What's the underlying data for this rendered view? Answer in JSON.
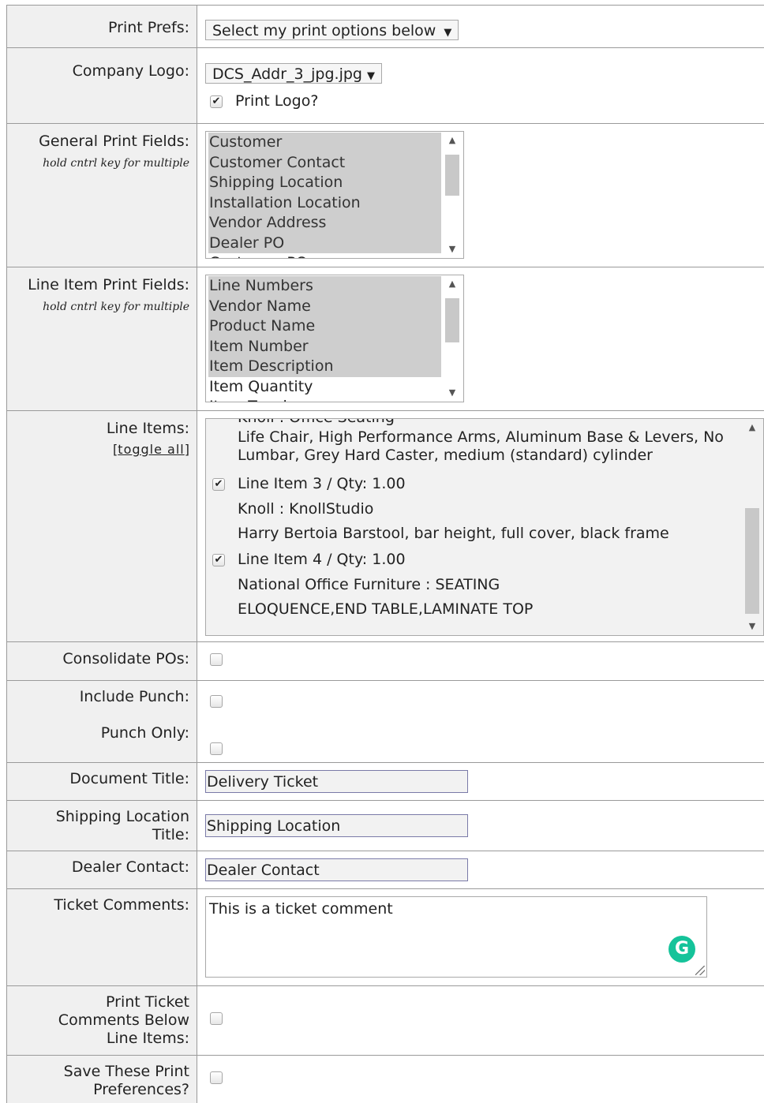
{
  "print_prefs": {
    "label": "Print Prefs:",
    "selected": "Select my print options below"
  },
  "company_logo": {
    "label": "Company Logo:",
    "selected": "DCS_Addr_3_jpg.jpg",
    "print_logo_label": "Print Logo?",
    "print_logo_checked": true
  },
  "general_fields": {
    "label": "General Print Fields:",
    "hint": "hold cntrl key for multiple",
    "options": [
      {
        "text": "Customer",
        "selected": true
      },
      {
        "text": "Customer Contact",
        "selected": true
      },
      {
        "text": "Shipping Location",
        "selected": true
      },
      {
        "text": "Installation Location",
        "selected": true
      },
      {
        "text": "Vendor Address",
        "selected": true
      },
      {
        "text": "Dealer PO",
        "selected": true
      },
      {
        "text": "Customer PO",
        "selected": false
      }
    ]
  },
  "line_item_fields": {
    "label": "Line Item Print Fields:",
    "hint": "hold cntrl key for multiple",
    "options": [
      {
        "text": "Line Numbers",
        "selected": true
      },
      {
        "text": "Vendor Name",
        "selected": true
      },
      {
        "text": "Product Name",
        "selected": true
      },
      {
        "text": "Item Number",
        "selected": true
      },
      {
        "text": "Item Description",
        "selected": true
      },
      {
        "text": "Item Quantity",
        "selected": false
      },
      {
        "text": "Item Tagging",
        "selected": false
      }
    ]
  },
  "line_items": {
    "label": "Line Items:",
    "toggle_all": "toggle all",
    "partial_top": "Knoll : Office Seating",
    "item2_desc": "Life Chair, High Performance Arms, Aluminum Base & Levers, No Lumbar, Grey Hard Caster, medium (standard) cylinder",
    "item3": {
      "title": "Line Item 3 / Qty: 1.00",
      "vendor": "Knoll : KnollStudio",
      "desc": "Harry Bertoia Barstool, bar height, full cover, black frame",
      "checked": true
    },
    "item4": {
      "title": "Line Item 4 / Qty: 1.00",
      "vendor": "National Office Furniture : SEATING",
      "desc": "ELOQUENCE,END TABLE,LAMINATE TOP",
      "checked": true
    }
  },
  "consolidate": {
    "label": "Consolidate POs:"
  },
  "include_punch": {
    "label": "Include Punch:"
  },
  "punch_only": {
    "label": "Punch Only:"
  },
  "document_title": {
    "label": "Document Title:",
    "value": "Delivery Ticket"
  },
  "shipping_title": {
    "label": "Shipping Location Title:",
    "value": "Shipping Location"
  },
  "dealer_contact": {
    "label": "Dealer Contact:",
    "value": "Dealer Contact"
  },
  "ticket_comments": {
    "label": "Ticket Comments:",
    "value": "This is a ticket comment",
    "badge": "G"
  },
  "print_below": {
    "label": "Print Ticket Comments Below Line Items:"
  },
  "save_prefs": {
    "label": "Save These Print Preferences?"
  },
  "icons": {
    "check": "✔",
    "arrow_down": "▼",
    "scroll_up": "▲",
    "scroll_down": "▼"
  }
}
